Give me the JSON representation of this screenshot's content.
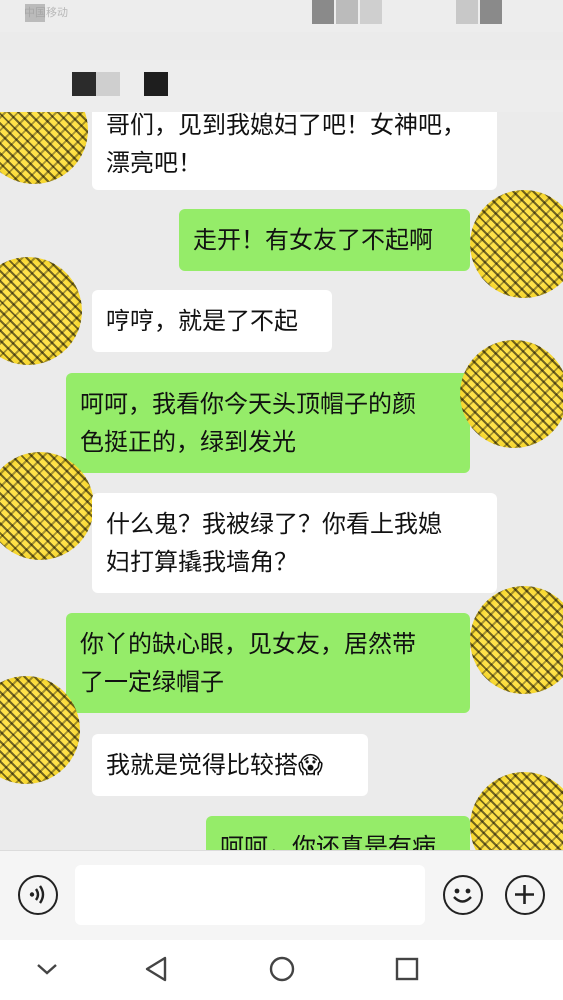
{
  "status_bar": {
    "carrier": "中国移动"
  },
  "chat": {
    "messages": [
      {
        "side": "left",
        "lines": [
          "哥们，见到我媳妇了吧！女神吧，",
          "漂亮吧！"
        ]
      },
      {
        "side": "right",
        "lines": [
          "走开！有女友了不起啊"
        ]
      },
      {
        "side": "left",
        "lines": [
          "哼哼，就是了不起"
        ]
      },
      {
        "side": "right",
        "lines": [
          "呵呵，我看你今天头顶帽子的颜",
          "色挺正的，绿到发光"
        ]
      },
      {
        "side": "left",
        "lines": [
          "什么鬼？我被绿了？你看上我媳",
          "妇打算撬我墙角？"
        ]
      },
      {
        "side": "right",
        "lines": [
          "你丫的缺心眼，见女友，居然带",
          "了一定绿帽子"
        ]
      },
      {
        "side": "left",
        "lines": [
          "我就是觉得比较搭"
        ],
        "emoji": "😱"
      },
      {
        "side": "right",
        "lines": [
          "呵呵，你还真是有病"
        ]
      }
    ]
  },
  "input_bar": {
    "voice_icon": "voice-icon",
    "emoji_icon": "emoji-icon",
    "add_icon": "add-icon"
  },
  "nav_bar": {
    "icons": [
      "collapse-chevron-icon",
      "back-triangle-icon",
      "home-circle-icon",
      "recents-square-icon"
    ]
  },
  "colors": {
    "chat_background": "#ebebeb",
    "bubble_received": "#ffffff",
    "bubble_sent": "#95ec69"
  }
}
